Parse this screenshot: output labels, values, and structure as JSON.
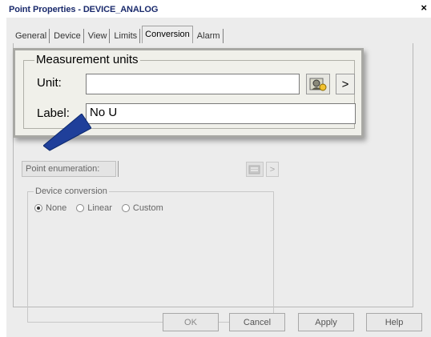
{
  "window": {
    "title": "Point Properties - DEVICE_ANALOG",
    "close_glyph": "×"
  },
  "tabs": [
    {
      "label": "General"
    },
    {
      "label": "Device"
    },
    {
      "label": "View"
    },
    {
      "label": "Limits"
    },
    {
      "label": "Conversion",
      "active": true
    },
    {
      "label": "Alarm"
    }
  ],
  "measurement_units": {
    "legend": "Measurement units",
    "unit_label": "Unit:",
    "unit_value": "",
    "label_label": "Label:",
    "label_value": "No U",
    "more_glyph": ">"
  },
  "point_enumeration": {
    "label": "Point enumeration:",
    "value": "",
    "more_glyph": ">"
  },
  "device_conversion": {
    "legend": "Device conversion",
    "options": [
      {
        "label": "None",
        "selected": true
      },
      {
        "label": "Linear",
        "selected": false
      },
      {
        "label": "Custom",
        "selected": false
      }
    ]
  },
  "buttons": {
    "ok": "OK",
    "cancel": "Cancel",
    "apply": "Apply",
    "help": "Help"
  },
  "colors": {
    "title_text": "#1a2a6c",
    "pointer_arrow": "#1f3f9a"
  }
}
